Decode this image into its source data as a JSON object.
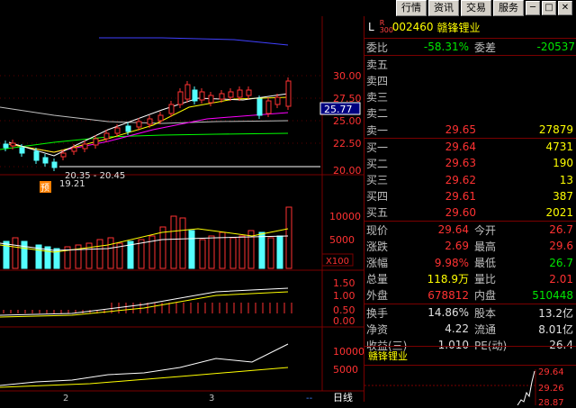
{
  "toolbar": {
    "tabs": [
      "行情",
      "资讯",
      "交易",
      "服务"
    ],
    "minimize": "─",
    "restore": "□",
    "close": "✕"
  },
  "stock": {
    "market_flag": "L",
    "badge": "R\n300",
    "code": "002460",
    "name": "赣锋锂业"
  },
  "ratio": {
    "label_wb": "委比",
    "wb": "-58.31%",
    "label_wc": "委差",
    "wc": "-20537"
  },
  "asks": [
    {
      "label": "卖五",
      "price": "",
      "vol": ""
    },
    {
      "label": "卖四",
      "price": "",
      "vol": ""
    },
    {
      "label": "卖三",
      "price": "",
      "vol": ""
    },
    {
      "label": "卖二",
      "price": "",
      "vol": ""
    },
    {
      "label": "卖一",
      "price": "29.65",
      "vol": "27879"
    }
  ],
  "bids": [
    {
      "label": "买一",
      "price": "29.64",
      "vol": "4731"
    },
    {
      "label": "买二",
      "price": "29.63",
      "vol": "190"
    },
    {
      "label": "买三",
      "price": "29.62",
      "vol": "13"
    },
    {
      "label": "买四",
      "price": "29.61",
      "vol": "387"
    },
    {
      "label": "买五",
      "price": "29.60",
      "vol": "2021"
    }
  ],
  "quote": [
    {
      "l1": "现价",
      "v1": "29.64",
      "l2": "今开",
      "v2": "26.7"
    },
    {
      "l1": "涨跌",
      "v1": "2.69",
      "l2": "最高",
      "v2": "29.6"
    },
    {
      "l1": "涨幅",
      "v1": "9.98%",
      "l2": "最低",
      "v2": "26.7"
    },
    {
      "l1": "总量",
      "v1": "118.9万",
      "l2": "量比",
      "v2": "2.01"
    },
    {
      "l1": "外盘",
      "v1": "678812",
      "l2": "内盘",
      "v2": "510448"
    }
  ],
  "fund": [
    {
      "l1": "换手",
      "v1": "14.86%",
      "l2": "股本",
      "v2": "13.2亿"
    },
    {
      "l1": "净资",
      "v1": "4.22",
      "l2": "流通",
      "v2": "8.01亿"
    },
    {
      "l1": "收益(三)",
      "v1": "1.010",
      "l2": "PE(动)",
      "v2": "26.4"
    }
  ],
  "mini_chart": {
    "title": "赣锋锂业",
    "price_hi": "29.64",
    "price_mid": "29.26",
    "price_lo": "28.87"
  },
  "chart": {
    "price_ticks": [
      "30.00",
      "27.50",
      "25.00",
      "22.50",
      "20.00"
    ],
    "current_price_tag": "25.77",
    "range_label": "20.35 - 20.45",
    "low_label": "19.21",
    "pre_badge": "预",
    "vol_ticks": [
      "10000",
      "5000"
    ],
    "vol_unit": "X100",
    "macd_ticks": [
      "1.50",
      "1.00",
      "0.50",
      "0.00"
    ],
    "obv_ticks": [
      "10000",
      "5000"
    ],
    "x_labels": [
      "2",
      "3"
    ],
    "bottom_label": "日线",
    "bottom_arrow": "--"
  },
  "colors": {
    "up": "#ff3232",
    "down": "#54ffff",
    "ma5": "#ffffff",
    "ma10": "#ffff00",
    "ma20": "#ff00ff",
    "ma60": "#00ff00"
  }
}
